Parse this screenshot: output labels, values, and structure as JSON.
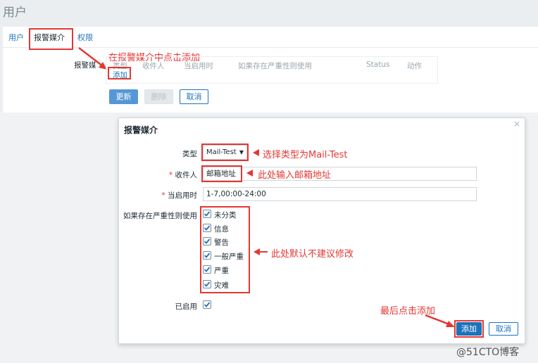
{
  "page": {
    "title": "用户"
  },
  "tabs": [
    {
      "label": "用户"
    },
    {
      "label": "报警媒介"
    },
    {
      "label": "权限"
    }
  ],
  "media": {
    "side_label": "报警媒",
    "columns": [
      "类型",
      "收件人",
      "当启用时",
      "如果存在严重性则使用",
      "Status",
      "动作"
    ],
    "add_link": "添加"
  },
  "form_buttons": {
    "update": "更新",
    "delete": "删除",
    "cancel": "取消"
  },
  "dialog": {
    "title": "报警媒介",
    "close": "×",
    "type_label": "类型",
    "type_value": "Mail-Test",
    "recipient_label": "收件人",
    "recipient_value": "邮箱地址",
    "when_label": "当启用时",
    "when_value": "1-7,00:00-24:00",
    "severity_label": "如果存在严重性则使用",
    "severities": [
      {
        "label": "未分类",
        "checked": true
      },
      {
        "label": "信息",
        "checked": true
      },
      {
        "label": "警告",
        "checked": true
      },
      {
        "label": "一般严重",
        "checked": true
      },
      {
        "label": "严重",
        "checked": true
      },
      {
        "label": "灾难",
        "checked": true
      }
    ],
    "enabled_label": "已启用",
    "enabled": true,
    "add_button": "添加",
    "cancel_button": "取消"
  },
  "annotations": {
    "click_add": "在报警媒介中点击添加",
    "select_type": "选择类型为Mail-Test",
    "enter_email": "此处输入邮箱地址",
    "default_note": "此处默认不建议修改",
    "final_add": "最后点击添加"
  },
  "watermark": "@51CTO博客",
  "colors": {
    "accent": "#1c73bd",
    "annotation": "#e33734"
  }
}
